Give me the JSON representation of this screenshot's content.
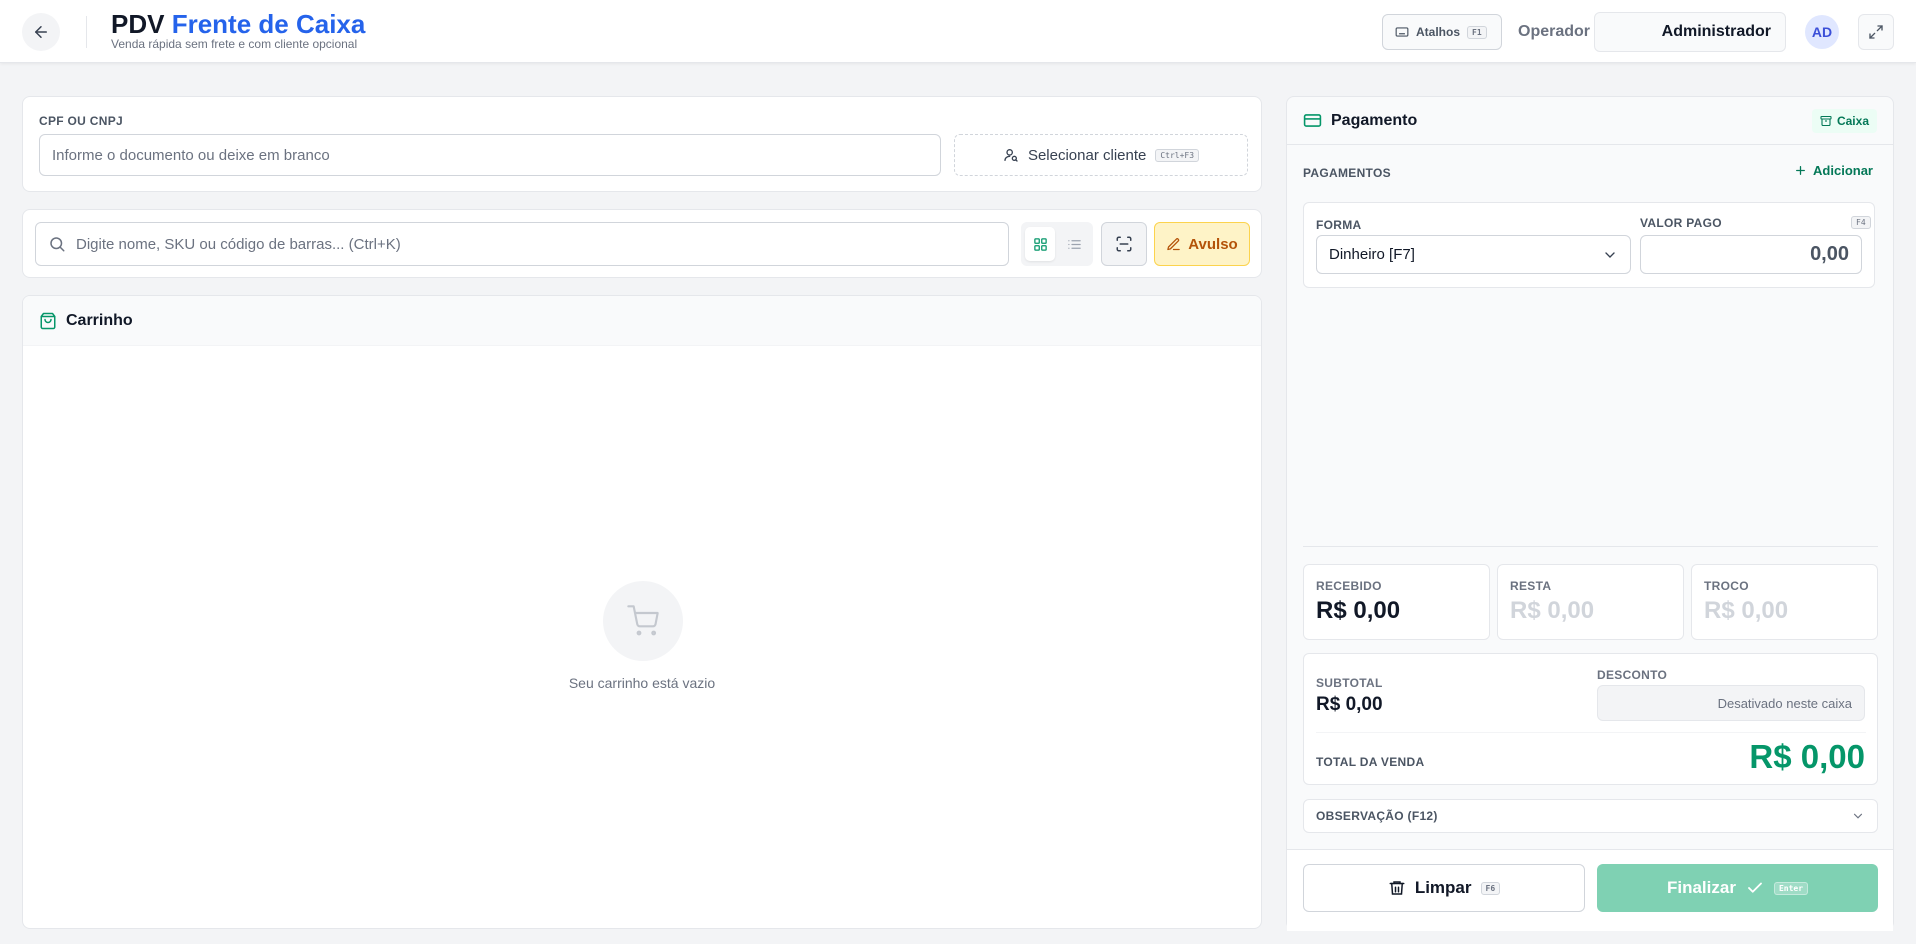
{
  "header": {
    "title_prefix": "PDV",
    "title_accent": "Frente de Caixa",
    "subtitle": "Venda rápida sem frete e com cliente opcional",
    "shortcuts_label": "Atalhos",
    "shortcuts_key": "F1",
    "operator_label": "Operador",
    "operator_value": "Administrador",
    "avatar_initials": "AD"
  },
  "client": {
    "doc_label": "CPF OU CNPJ",
    "doc_placeholder": "Informe o documento ou deixe em branco",
    "select_label": "Selecionar cliente",
    "select_key": "Ctrl+F3"
  },
  "search": {
    "placeholder": "Digite nome, SKU ou código de barras... (Ctrl+K)",
    "loose_label": "Avulso"
  },
  "cart": {
    "title": "Carrinho",
    "empty_text": "Seu carrinho está vazio"
  },
  "payment": {
    "title": "Pagamento",
    "badge": "Caixa",
    "payments_label": "PAGAMENTOS",
    "add_label": "Adicionar",
    "forma_label": "FORMA",
    "forma_value": "Dinheiro [F7]",
    "valor_label": "VALOR PAGO",
    "valor_key": "F4",
    "valor_value": "0,00",
    "received_label": "RECEBIDO",
    "received_value": "R$ 0,00",
    "remaining_label": "RESTA",
    "remaining_value": "R$ 0,00",
    "change_label": "TROCO",
    "change_value": "R$ 0,00",
    "subtotal_label": "SUBTOTAL",
    "subtotal_value": "R$ 0,00",
    "discount_label": "DESCONTO",
    "discount_value": "Desativado neste caixa",
    "total_label": "TOTAL DA VENDA",
    "total_value": "R$ 0,00",
    "observation_label": "OBSERVAÇÃO (F12)",
    "clear_label": "Limpar",
    "clear_key": "F6",
    "finish_label": "Finalizar",
    "finish_key": "Enter"
  },
  "colors": {
    "accent_blue": "#2563eb",
    "success_green": "#059669",
    "finish_disabled": "#7fd1b3",
    "loose_amber": "#b45309"
  }
}
